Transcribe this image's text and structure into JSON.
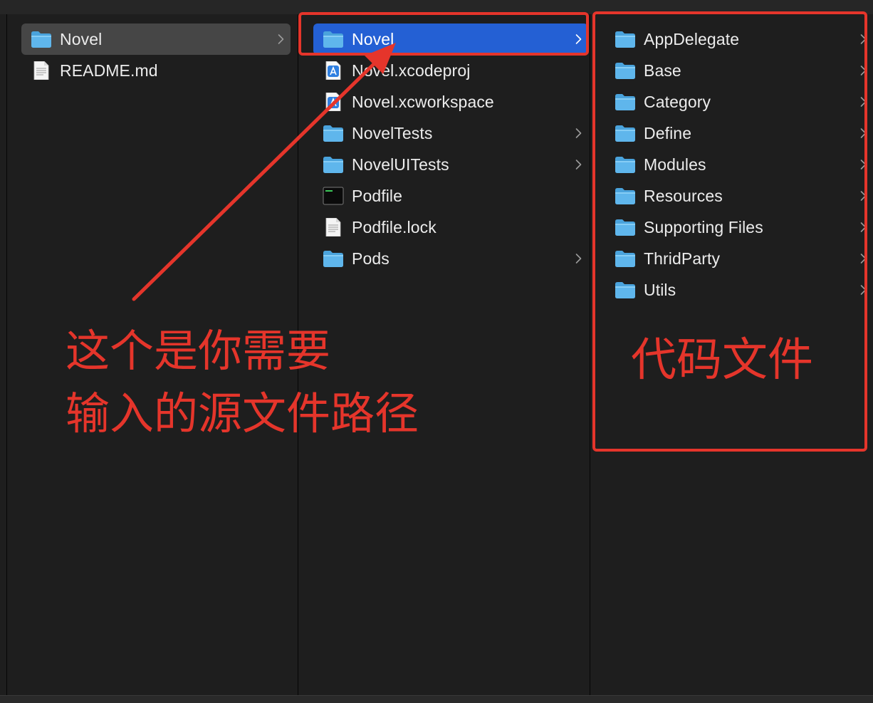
{
  "columns": [
    {
      "items": [
        {
          "label": "Novel",
          "icon": "folder-icon",
          "chevron": true,
          "selected": "inactive"
        },
        {
          "label": "README.md",
          "icon": "text-document-icon",
          "chevron": false,
          "selected": "none"
        }
      ]
    },
    {
      "items": [
        {
          "label": "Novel",
          "icon": "folder-icon",
          "chevron": true,
          "selected": "active"
        },
        {
          "label": "Novel.xcodeproj",
          "icon": "xcode-project-icon",
          "chevron": false,
          "selected": "none"
        },
        {
          "label": "Novel.xcworkspace",
          "icon": "xcode-workspace-icon",
          "chevron": false,
          "selected": "none"
        },
        {
          "label": "NovelTests",
          "icon": "folder-icon",
          "chevron": true,
          "selected": "none"
        },
        {
          "label": "NovelUITests",
          "icon": "folder-icon",
          "chevron": true,
          "selected": "none"
        },
        {
          "label": "Podfile",
          "icon": "terminal-file-icon",
          "chevron": false,
          "selected": "none"
        },
        {
          "label": "Podfile.lock",
          "icon": "text-document-icon",
          "chevron": false,
          "selected": "none"
        },
        {
          "label": "Pods",
          "icon": "folder-icon",
          "chevron": true,
          "selected": "none"
        }
      ]
    },
    {
      "items": [
        {
          "label": "AppDelegate",
          "icon": "folder-icon",
          "chevron": true,
          "selected": "none"
        },
        {
          "label": "Base",
          "icon": "folder-icon",
          "chevron": true,
          "selected": "none"
        },
        {
          "label": "Category",
          "icon": "folder-icon",
          "chevron": true,
          "selected": "none"
        },
        {
          "label": "Define",
          "icon": "folder-icon",
          "chevron": true,
          "selected": "none"
        },
        {
          "label": "Modules",
          "icon": "folder-icon",
          "chevron": true,
          "selected": "none"
        },
        {
          "label": "Resources",
          "icon": "folder-icon",
          "chevron": true,
          "selected": "none"
        },
        {
          "label": "Supporting Files",
          "icon": "folder-icon",
          "chevron": true,
          "selected": "none"
        },
        {
          "label": "ThridParty",
          "icon": "folder-icon",
          "chevron": true,
          "selected": "none"
        },
        {
          "label": "Utils",
          "icon": "folder-icon",
          "chevron": true,
          "selected": "none"
        }
      ]
    }
  ],
  "annotations": {
    "left_note_line1": "这个是你需要",
    "left_note_line2": "输入的源文件路径",
    "right_note": "代码文件",
    "color": "#e5352b"
  },
  "colors": {
    "background": "#1e1e1e",
    "selection_active": "#2460d4",
    "selection_inactive": "#464646",
    "folder": "#5fb6ec",
    "text": "#ececec"
  }
}
